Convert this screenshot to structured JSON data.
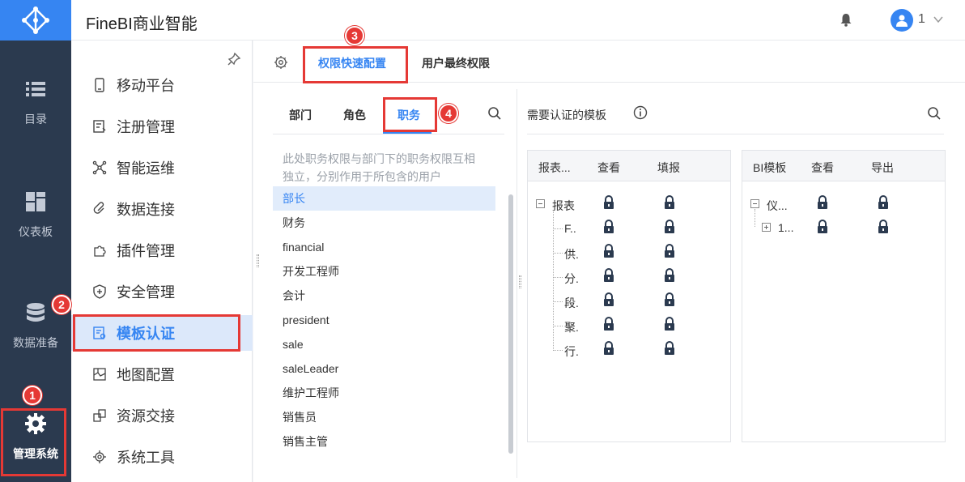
{
  "app": {
    "title": "FineBI商业智能",
    "user": "1"
  },
  "nav": {
    "items": [
      {
        "label": "目录",
        "icon": "list-icon"
      },
      {
        "label": "仪表板",
        "icon": "dashboard-icon"
      },
      {
        "label": "数据准备",
        "icon": "database-icon"
      },
      {
        "label": "管理系统",
        "icon": "gear-icon"
      }
    ]
  },
  "submenu": {
    "items": [
      {
        "label": "移动平台"
      },
      {
        "label": "注册管理"
      },
      {
        "label": "智能运维"
      },
      {
        "label": "数据连接"
      },
      {
        "label": "插件管理"
      },
      {
        "label": "安全管理"
      },
      {
        "label": "模板认证"
      },
      {
        "label": "地图配置"
      },
      {
        "label": "资源交接"
      },
      {
        "label": "系统工具"
      }
    ]
  },
  "tabs": {
    "quick": "权限快速配置",
    "final": "用户最终权限"
  },
  "left": {
    "tabs": {
      "dept": "部门",
      "role": "角色",
      "post": "职务"
    },
    "hint": "此处职务权限与部门下的职务权限互相独立，分别作用于所包含的用户",
    "roles": [
      "部长",
      "财务",
      "financial",
      "开发工程师",
      "会计",
      "president",
      "sale",
      "saleLeader",
      "维护工程师",
      "销售员",
      "销售主管"
    ]
  },
  "right": {
    "title": "需要认证的模板",
    "report": {
      "col1": "报表...",
      "col2": "查看",
      "col3": "填报",
      "root": "报表",
      "children": [
        "F..",
        "供.",
        "分.",
        "段.",
        "聚.",
        "行."
      ]
    },
    "bi": {
      "col1": "BI模板",
      "col2": "查看",
      "col3": "导出",
      "root": "仪...",
      "child": "1..."
    }
  },
  "callouts": {
    "c1": "1",
    "c2": "2",
    "c3": "3",
    "c4": "4"
  },
  "colors": {
    "accent": "#3685f2",
    "nav_bg": "#2b3a4f",
    "callout": "#e53935"
  }
}
